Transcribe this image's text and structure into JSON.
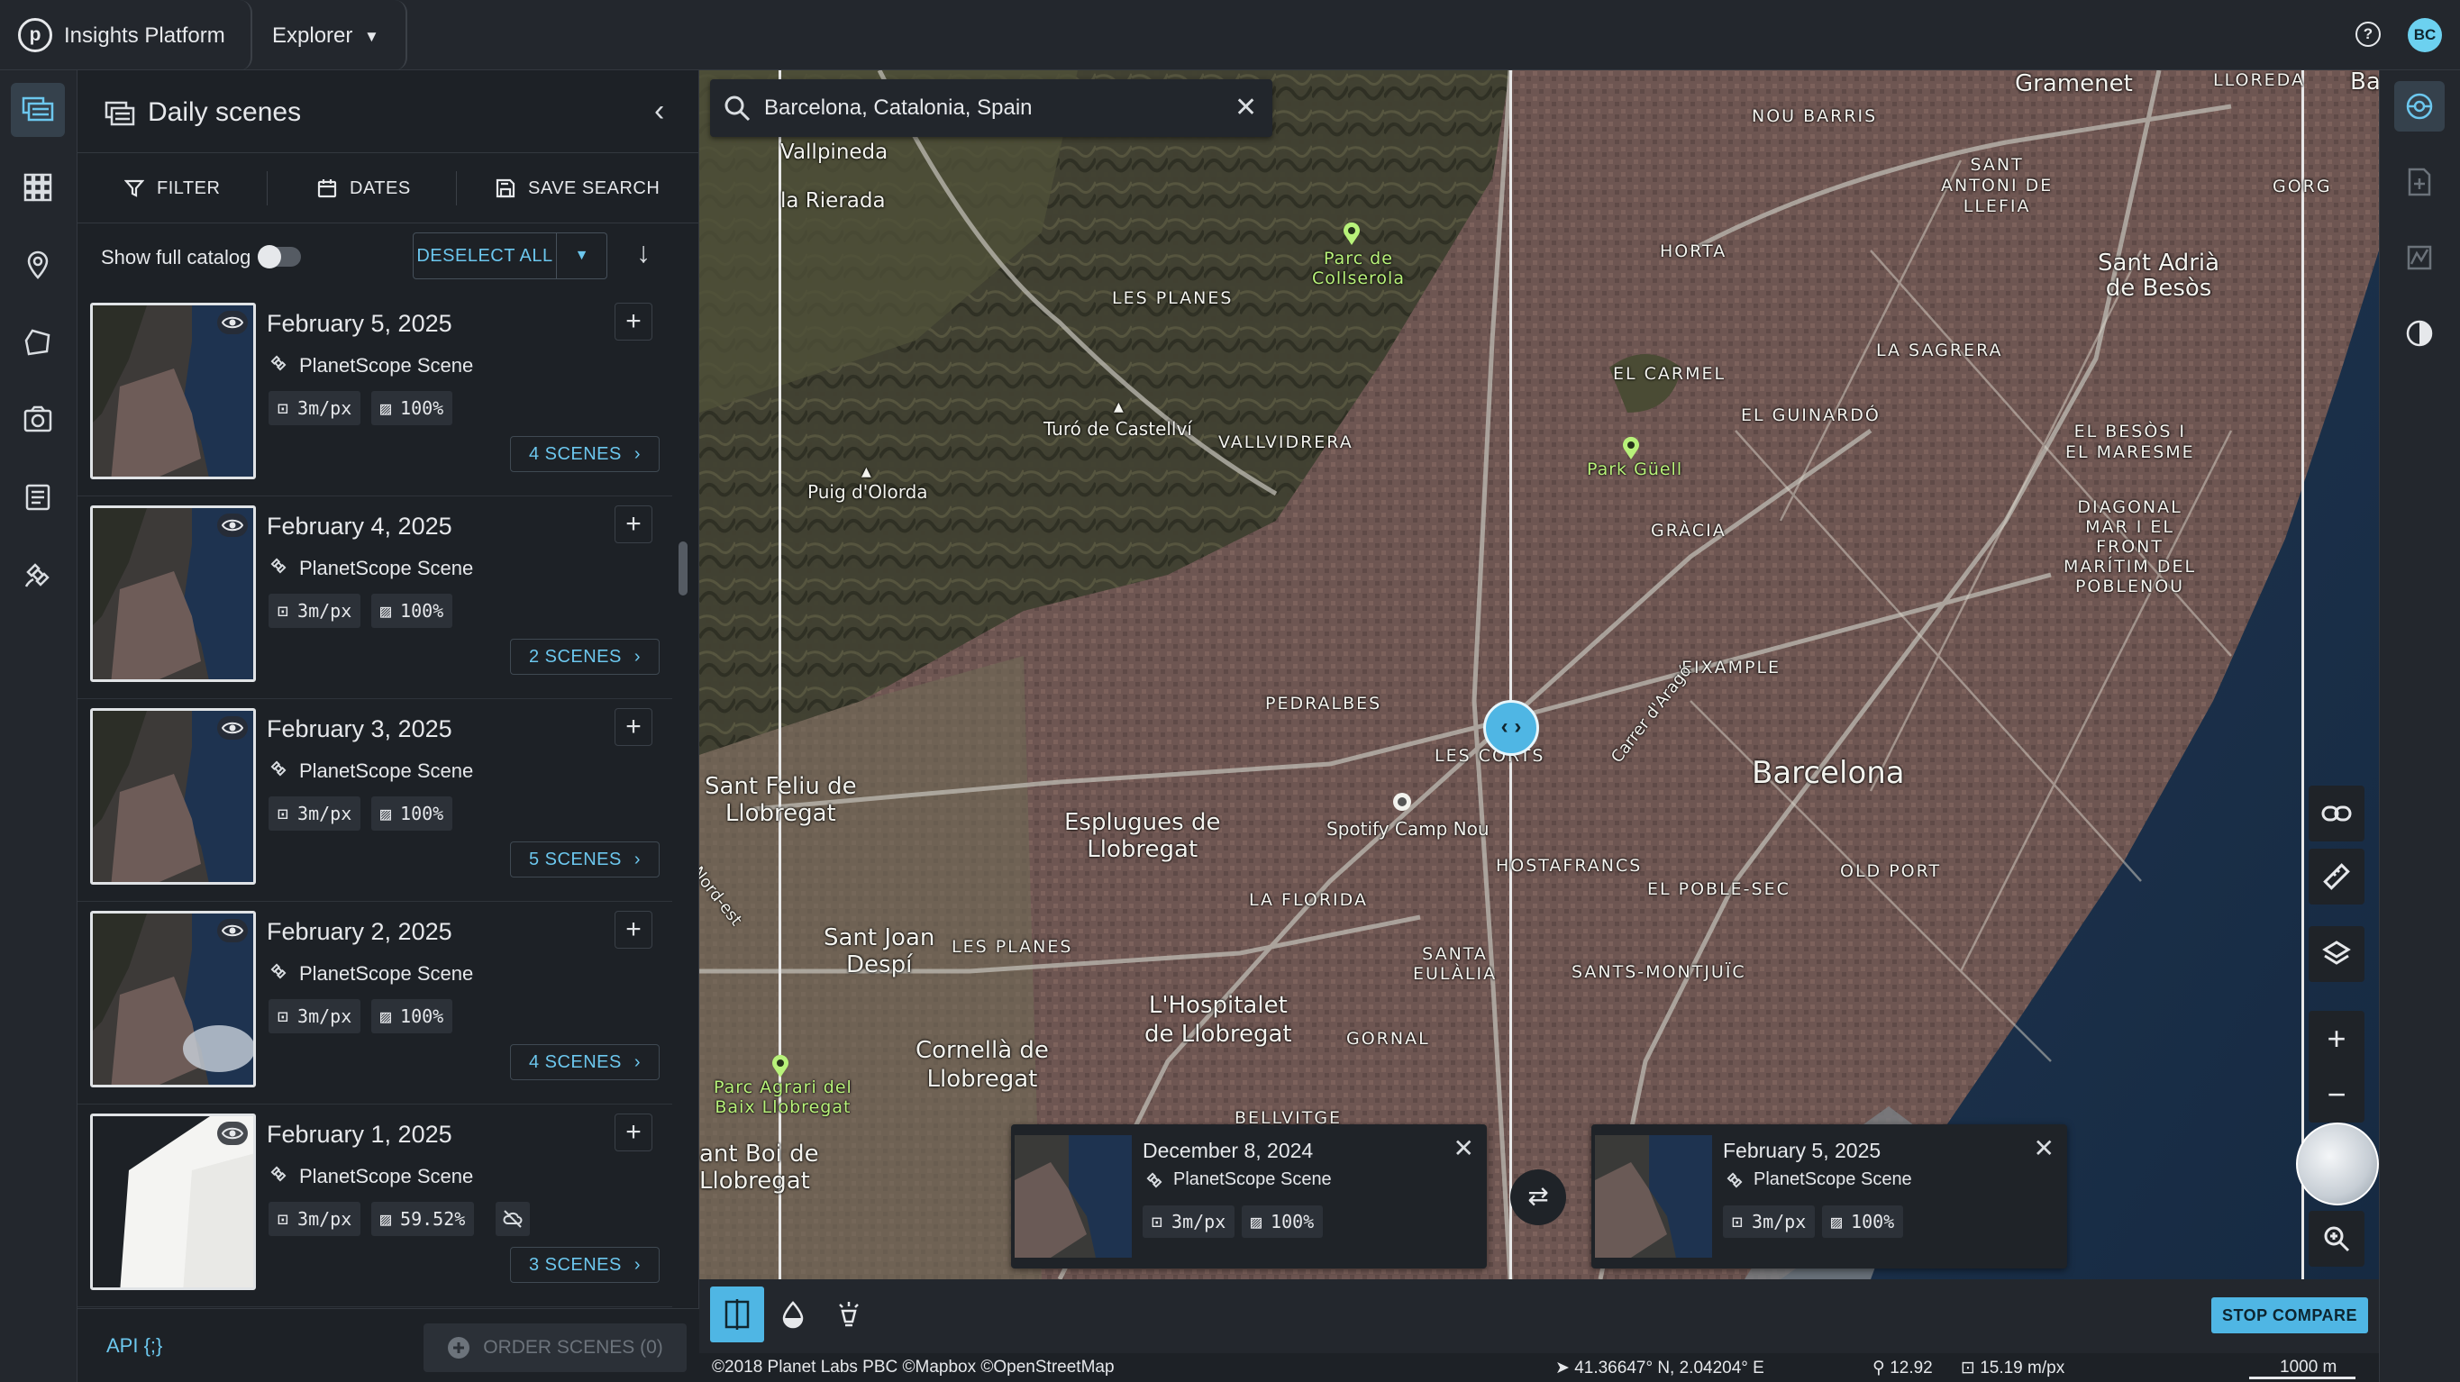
{
  "app": {
    "title": "Insights Platform",
    "logo_letter": "p",
    "section": "Explorer",
    "user_initials": "BC",
    "help_glyph": "?"
  },
  "panel": {
    "title": "Daily scenes",
    "filter_label": "FILTER",
    "dates_label": "DATES",
    "save_search_label": "SAVE SEARCH",
    "show_catalog_label": "Show full catalog",
    "show_catalog_on": false,
    "deselect_label": "DESELECT ALL",
    "scenes": [
      {
        "date": "February 5, 2025",
        "type": "PlanetScope Scene",
        "resolution": "3m/px",
        "coverage": "100%",
        "count_label": "4 SCENES",
        "partial": false
      },
      {
        "date": "February 4, 2025",
        "type": "PlanetScope Scene",
        "resolution": "3m/px",
        "coverage": "100%",
        "count_label": "2 SCENES",
        "partial": false
      },
      {
        "date": "February 3, 2025",
        "type": "PlanetScope Scene",
        "resolution": "3m/px",
        "coverage": "100%",
        "count_label": "5 SCENES",
        "partial": false
      },
      {
        "date": "February 2, 2025",
        "type": "PlanetScope Scene",
        "resolution": "3m/px",
        "coverage": "100%",
        "count_label": "4 SCENES",
        "partial": false
      },
      {
        "date": "February 1, 2025",
        "type": "PlanetScope Scene",
        "resolution": "3m/px",
        "coverage": "59.52%",
        "count_label": "3 SCENES",
        "partial": true
      }
    ],
    "api_label": "API {;}",
    "order_label": "ORDER SCENES (0)"
  },
  "map": {
    "search_value": "Barcelona, Catalonia, Spain",
    "labels": {
      "barcelona": "Barcelona",
      "sant_adria": "Sant Adrià\nde Besòs",
      "gramenet": "Gramenet",
      "esplugues": "Esplugues de\nLlobregat",
      "hospitalet": "L'Hospitalet\nde Llobregat",
      "cornella": "Cornellà de\nLlobregat",
      "sant_joan": "Sant Joan\nDespí",
      "sant_feliu": "Sant Feliu de\nLlobregat",
      "sant_boi": "ant Boi de\nLlobregat",
      "vallpineda": "Vallpineda",
      "la_rierada": "la Rierada",
      "les_planes": "LES PLANES",
      "les_planes2": "LES PLANES",
      "vallvidrera": "VALLVIDRERA",
      "turo": "Turó de Castellví",
      "puig": "Puig d'Olorda",
      "parc_collserola": "Parc de\nCollserola",
      "park_guell": "Park Güell",
      "horta": "HORTA",
      "el_carmel": "EL CARMEL",
      "el_guinardo": "EL GUINARDÓ",
      "la_sagrera": "LA SAGRERA",
      "nou_barris": "NOU BARRIS",
      "sant_antoni": "SANT\nANTONI DE\nLLEFIA",
      "gorg": "GORG",
      "llefia": "LLOREDA",
      "gracia": "GRÀCIA",
      "besos": "EL BESÒS I\nEL MARESME",
      "diagonal": "DIAGONAL\nMAR I EL\nFRONT\nMARÍTIM DEL\nPOBLENOU",
      "eixample": "EIXAMPLE",
      "pedralbes": "PEDRALBES",
      "les_corts": "LES CORTS",
      "spotify": "Spotify Camp Nou",
      "hostafrancs": "HOSTAFRANCS",
      "poble_sec": "EL POBLE-SEC",
      "old_port": "OLD PORT",
      "la_florida": "LA FLORIDA",
      "santa_eulalia": "SANTA\nEULÀLIA",
      "sants": "SANTS-MONTJUÏC",
      "gornal": "GORNAL",
      "bellvitge": "BELLVITGE",
      "parc_agrari": "Parc Agrari del\nBaix Llobregat",
      "carrer_arago": "Carrer d'Aragó",
      "nordest": "Nord-est",
      "bac": "Bac"
    },
    "compare_left": {
      "date": "December 8, 2024",
      "type": "PlanetScope Scene",
      "resolution": "3m/px",
      "coverage": "100%"
    },
    "compare_right": {
      "date": "February 5, 2025",
      "type": "PlanetScope Scene",
      "resolution": "3m/px",
      "coverage": "100%"
    },
    "stop_compare_label": "STOP COMPARE",
    "status": {
      "attribution": "©2018 Planet Labs PBC ©Mapbox ©OpenStreetMap",
      "coords": "41.36647° N, 2.04204° E",
      "zoom": "12.92",
      "resolution": "15.19 m/px",
      "scale": "1000 m"
    }
  },
  "icons": {
    "rail": [
      "layers-list-icon",
      "mosaic-grid-icon",
      "location-pin-icon",
      "aoi-polygon-icon",
      "camera-tasking-icon",
      "orders-list-icon",
      "satellite-icon"
    ],
    "map_tools": [
      "link-icon",
      "ruler-icon",
      "layers-icon",
      "zoom-in-icon",
      "zoom-out-icon",
      "globe-icon",
      "magnify-icon"
    ],
    "accent": "#4fb6e4"
  }
}
